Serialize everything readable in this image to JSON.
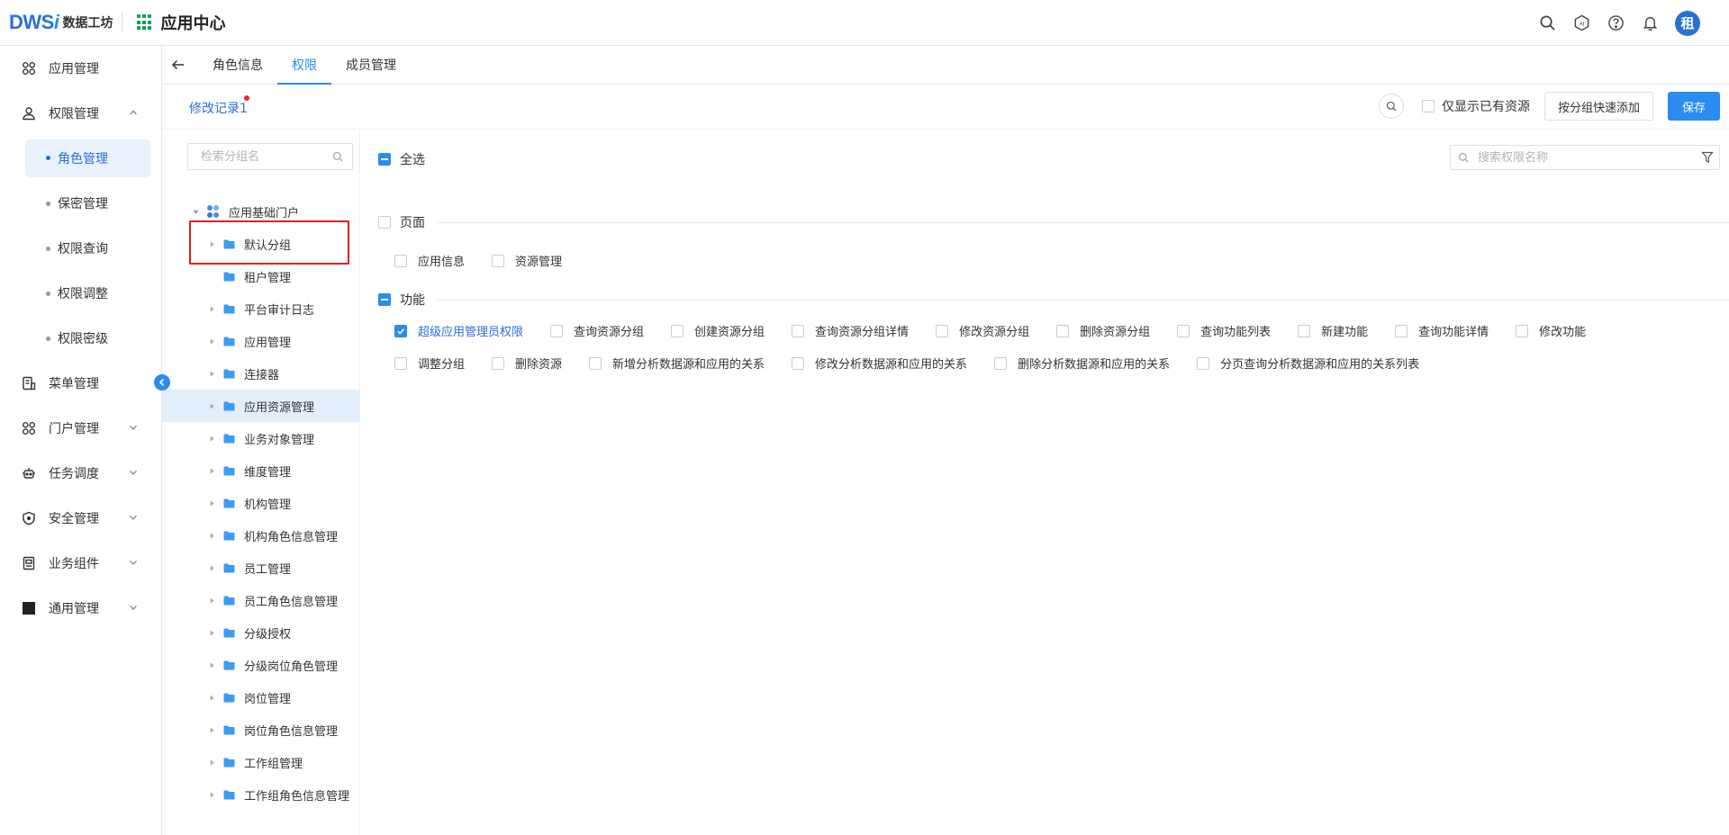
{
  "topbar": {
    "logo_text": "数据工坊",
    "logo_mark_main": "DWS",
    "logo_mark_i": "i",
    "app_title": "应用中心",
    "avatar_text": "租",
    "ai_label": "AI"
  },
  "sidebar": {
    "items": [
      {
        "label": "应用管理",
        "icon": "grid-apps-icon"
      },
      {
        "label": "权限管理",
        "icon": "user-lock-icon",
        "expanded": true
      },
      {
        "label": "菜单管理",
        "icon": "menu-doc-icon"
      },
      {
        "label": "门户管理",
        "icon": "grid-apps-icon"
      },
      {
        "label": "任务调度",
        "icon": "robot-icon"
      },
      {
        "label": "安全管理",
        "icon": "shield-icon"
      },
      {
        "label": "业务组件",
        "icon": "component-icon"
      },
      {
        "label": "通用管理",
        "icon": "square-icon"
      }
    ],
    "sub_items": [
      {
        "label": "角色管理",
        "active": true
      },
      {
        "label": "保密管理"
      },
      {
        "label": "权限查询"
      },
      {
        "label": "权限调整"
      },
      {
        "label": "权限密级"
      }
    ]
  },
  "tabs": [
    {
      "label": "角色信息"
    },
    {
      "label": "权限",
      "active": true
    },
    {
      "label": "成员管理"
    }
  ],
  "toolbar": {
    "history_label": "修改记录",
    "history_count": "1",
    "only_existing_label": "仅显示已有资源",
    "quick_add_label": "按分组快速添加",
    "save_label": "保存"
  },
  "tree": {
    "search_placeholder": "检索分组名",
    "root_label": "应用基础门户",
    "children": [
      {
        "label": "默认分组",
        "has_children": true
      },
      {
        "label": "租户管理",
        "has_children": false
      },
      {
        "label": "平台审计日志",
        "has_children": true
      },
      {
        "label": "应用管理",
        "has_children": true
      },
      {
        "label": "连接器",
        "has_children": true
      },
      {
        "label": "应用资源管理",
        "has_children": true,
        "selected": true
      },
      {
        "label": "业务对象管理",
        "has_children": true
      },
      {
        "label": "维度管理",
        "has_children": true
      },
      {
        "label": "机构管理",
        "has_children": true
      },
      {
        "label": "机构角色信息管理",
        "has_children": true
      },
      {
        "label": "员工管理",
        "has_children": true
      },
      {
        "label": "员工角色信息管理",
        "has_children": true
      },
      {
        "label": "分级授权",
        "has_children": true
      },
      {
        "label": "分级岗位角色管理",
        "has_children": true
      },
      {
        "label": "岗位管理",
        "has_children": true
      },
      {
        "label": "岗位角色信息管理",
        "has_children": true
      },
      {
        "label": "工作组管理",
        "has_children": true
      },
      {
        "label": "工作组角色信息管理",
        "has_children": true
      }
    ]
  },
  "permissions": {
    "select_all_label": "全选",
    "search_placeholder": "搜索权限名称",
    "page_section": {
      "label": "页面",
      "items": [
        "应用信息",
        "资源管理"
      ]
    },
    "function_section": {
      "label": "功能",
      "row1": [
        "超级应用管理员权限",
        "查询资源分组",
        "创建资源分组",
        "查询资源分组详情",
        "修改资源分组",
        "删除资源分组",
        "查询功能列表",
        "新建功能",
        "查询功能详情",
        "修改功能"
      ],
      "row2": [
        "调整分组",
        "删除资源",
        "新增分析数据源和应用的关系",
        "修改分析数据源和应用的关系",
        "删除分析数据源和应用的关系",
        "分页查询分析数据源和应用的关系列表"
      ],
      "checked": [
        "超级应用管理员权限"
      ]
    }
  },
  "colors": {
    "primary": "#2b8cf0",
    "highlight_border": "#e02020",
    "selected_bg": "#e3eefb"
  }
}
